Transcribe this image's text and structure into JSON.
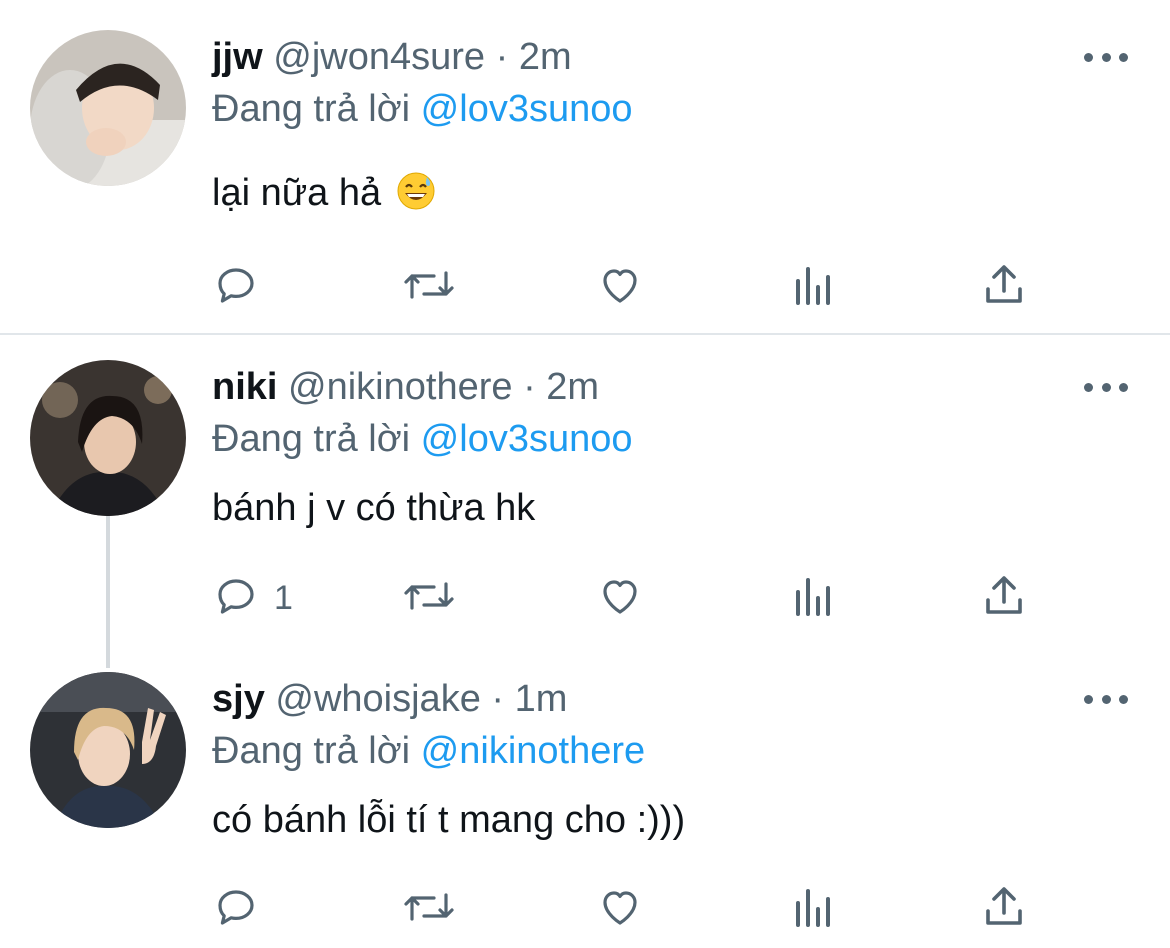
{
  "colors": {
    "text_primary": "#0f1419",
    "text_secondary": "#536471",
    "mention": "#1d9bf0",
    "divider": "#e1e6ea"
  },
  "reply_prefix": "Đang trả lời",
  "tweets": [
    {
      "display_name": "jjw",
      "handle": "@jwon4sure",
      "separator": "·",
      "time": "2m",
      "reply_to": "@lov3sunoo",
      "text": "lại nữa hả",
      "emoji": "grinning-sweat-emoji",
      "reply_count": ""
    },
    {
      "display_name": "niki",
      "handle": "@nikinothere",
      "separator": "·",
      "time": "2m",
      "reply_to": "@lov3sunoo",
      "text": "bánh j v có thừa hk",
      "reply_count": "1"
    },
    {
      "display_name": "sjy",
      "handle": "@whoisjake",
      "separator": "·",
      "time": "1m",
      "reply_to": "@nikinothere",
      "text": "có bánh lỗi tí t mang cho :)))",
      "reply_count": ""
    }
  ],
  "action_icons": [
    "reply-icon",
    "retweet-icon",
    "like-icon",
    "analytics-icon",
    "share-icon"
  ]
}
